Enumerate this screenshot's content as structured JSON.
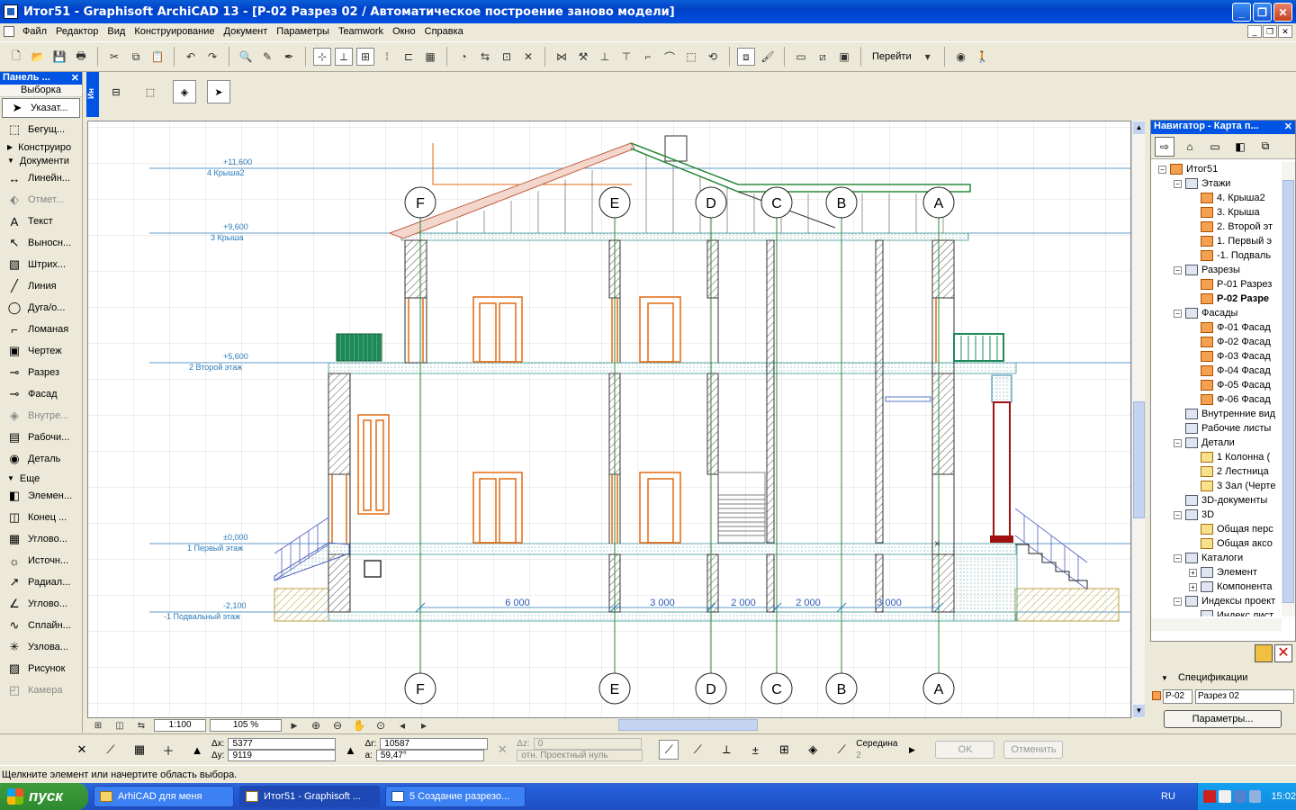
{
  "window": {
    "title": "Итог51 - Graphisoft ArchiCAD 13 - [Р-02 Разрез 02 / Автоматическое построение заново модели]"
  },
  "menu": [
    "Файл",
    "Редактор",
    "Вид",
    "Конструирование",
    "Документ",
    "Параметры",
    "Teamwork",
    "Окно",
    "Справка"
  ],
  "toolbar": {
    "goto_label": "Перейти"
  },
  "toolbox": {
    "title": "Панель ...",
    "selection_header": "Выборка",
    "select_tools": [
      {
        "label": "Указат...",
        "icon": "arrow-pointer-icon",
        "active": true
      },
      {
        "label": "Бегущ...",
        "icon": "marquee-icon"
      }
    ],
    "groups": [
      {
        "label": "Конструиро",
        "open": false
      },
      {
        "label": "Документи",
        "open": true
      }
    ],
    "doc_tools": [
      {
        "label": "Линейн...",
        "glyph": "↔",
        "name": "dimension-tool"
      },
      {
        "label": "Отмет...",
        "glyph": "⬖",
        "name": "level-dimension-tool",
        "dim": true
      },
      {
        "label": "Текст",
        "glyph": "A",
        "name": "text-tool"
      },
      {
        "label": "Выносн...",
        "glyph": "↖",
        "name": "label-tool"
      },
      {
        "label": "Штрих...",
        "glyph": "▧",
        "name": "fill-tool"
      },
      {
        "label": "Линия",
        "glyph": "╱",
        "name": "line-tool"
      },
      {
        "label": "Дуга/о...",
        "glyph": "◯",
        "name": "arc-tool"
      },
      {
        "label": "Ломаная",
        "glyph": "⌐",
        "name": "polyline-tool"
      },
      {
        "label": "Чертеж",
        "glyph": "▣",
        "name": "drawing-tool"
      },
      {
        "label": "Разрез",
        "glyph": "⊸",
        "name": "section-tool"
      },
      {
        "label": "Фасад",
        "glyph": "⊸",
        "name": "elevation-tool"
      },
      {
        "label": "Внутре...",
        "glyph": "◈",
        "name": "interior-elevation-tool",
        "dim": true
      },
      {
        "label": "Рабочи...",
        "glyph": "▤",
        "name": "worksheet-tool"
      },
      {
        "label": "Деталь",
        "glyph": "◉",
        "name": "detail-tool"
      }
    ],
    "more_header": "Еще",
    "more_tools": [
      {
        "label": "Элемен...",
        "glyph": "◧",
        "name": "object-tool"
      },
      {
        "label": "Конец ...",
        "glyph": "◫",
        "name": "wall-end-tool"
      },
      {
        "label": "Углово...",
        "glyph": "▦",
        "name": "corner-window-tool"
      },
      {
        "label": "Источн...",
        "glyph": "☼",
        "name": "lamp-tool"
      },
      {
        "label": "Радиал...",
        "glyph": "↗",
        "name": "radial-dimension-tool"
      },
      {
        "label": "Углово...",
        "glyph": "∠",
        "name": "angle-dimension-tool"
      },
      {
        "label": "Сплайн...",
        "glyph": "∿",
        "name": "spline-tool"
      },
      {
        "label": "Узлова...",
        "glyph": "✳",
        "name": "hotspot-tool"
      },
      {
        "label": "Рисунок",
        "glyph": "▨",
        "name": "figure-tool"
      },
      {
        "label": "Камера",
        "glyph": "◰",
        "name": "camera-tool",
        "dim": true
      }
    ]
  },
  "infobox": {
    "strip_label": "Ин"
  },
  "drawing": {
    "levels": [
      {
        "value": "+11,600",
        "name": "4 Крыша2"
      },
      {
        "value": "+9,600",
        "name": "3 Крыша"
      },
      {
        "value": "+5,600",
        "name": "2 Второй этаж"
      },
      {
        "value": "±0,000",
        "name": "1 Первый этаж"
      },
      {
        "value": "-2,100",
        "name": "-1 Подвальный этаж"
      }
    ],
    "axes": [
      "F",
      "E",
      "D",
      "C",
      "B",
      "A"
    ],
    "dimensions": [
      "6 000",
      "3 000",
      "2 000",
      "2 000",
      "3 000"
    ]
  },
  "canvasbar": {
    "scale": "1:100",
    "zoom": "105 %"
  },
  "navigator": {
    "title": "Навигатор - Карта п...",
    "tree": [
      {
        "label": "Итог51",
        "level": 0,
        "exp": "−",
        "icon": "house"
      },
      {
        "label": "Этажи",
        "level": 1,
        "exp": "−",
        "icon": "g"
      },
      {
        "label": "4. Крыша2",
        "level": 2,
        "icon": "s"
      },
      {
        "label": "3. Крыша",
        "level": 2,
        "icon": "s"
      },
      {
        "label": "2. Второй эт",
        "level": 2,
        "icon": "s"
      },
      {
        "label": "1. Первый э",
        "level": 2,
        "icon": "s"
      },
      {
        "label": "-1. Подваль",
        "level": 2,
        "icon": "s"
      },
      {
        "label": "Разрезы",
        "level": 1,
        "exp": "−",
        "icon": "g"
      },
      {
        "label": "Р-01 Разрез",
        "level": 2,
        "icon": "s"
      },
      {
        "label": "Р-02 Разре",
        "level": 2,
        "icon": "s",
        "bold": true
      },
      {
        "label": "Фасады",
        "level": 1,
        "exp": "−",
        "icon": "g"
      },
      {
        "label": "Ф-01 Фасад",
        "level": 2,
        "icon": "s"
      },
      {
        "label": "Ф-02 Фасад",
        "level": 2,
        "icon": "s"
      },
      {
        "label": "Ф-03 Фасад",
        "level": 2,
        "icon": "s"
      },
      {
        "label": "Ф-04 Фасад",
        "level": 2,
        "icon": "s"
      },
      {
        "label": "Ф-05 Фасад",
        "level": 2,
        "icon": "s"
      },
      {
        "label": "Ф-06 Фасад",
        "level": 2,
        "icon": "s"
      },
      {
        "label": "Внутренние вид",
        "level": 1,
        "icon": "g"
      },
      {
        "label": "Рабочие листы",
        "level": 1,
        "icon": "g"
      },
      {
        "label": "Детали",
        "level": 1,
        "exp": "−",
        "icon": "g"
      },
      {
        "label": "1 Колонна (",
        "level": 2,
        "icon": "f"
      },
      {
        "label": "2 Лестница",
        "level": 2,
        "icon": "f"
      },
      {
        "label": "3 Зал (Черте",
        "level": 2,
        "icon": "f"
      },
      {
        "label": "3D-документы",
        "level": 1,
        "icon": "g"
      },
      {
        "label": "3D",
        "level": 1,
        "exp": "−",
        "icon": "g"
      },
      {
        "label": "Общая перс",
        "level": 2,
        "icon": "f"
      },
      {
        "label": "Общая аксо",
        "level": 2,
        "icon": "f"
      },
      {
        "label": "Каталоги",
        "level": 1,
        "exp": "−",
        "icon": "g"
      },
      {
        "label": "Элемент",
        "level": 2,
        "exp": "+",
        "icon": "g"
      },
      {
        "label": "Компонента",
        "level": 2,
        "exp": "+",
        "icon": "g"
      },
      {
        "label": "Индексы проект",
        "level": 1,
        "exp": "−",
        "icon": "g"
      },
      {
        "label": "Индекс лист",
        "level": 2,
        "icon": "g"
      }
    ],
    "specs_label": "Спецификации",
    "spec_id": "Р-02",
    "spec_name": "Разрез 02",
    "params_button": "Параметры..."
  },
  "controlbar": {
    "dx_label": "Δx:",
    "dx": "5377",
    "dy_label": "Δy:",
    "dy": "9119",
    "dr_label": "Δr:",
    "dr": "10587",
    "da_label": "a:",
    "da": "59,47°",
    "dz_label": "Δz:",
    "dz": "0",
    "ref_label": "отн. Проектный нуль",
    "snap_label": "Середина",
    "snap_value": "2",
    "ok_label": "OK",
    "cancel_label": "Отменить"
  },
  "status": "Щелкните элемент или начертите область выбора.",
  "taskbar": {
    "start": "пуск",
    "tasks": [
      "ArhiCAD для меня",
      "Итог51 - Graphisoft ...",
      "5 Создание разрезо..."
    ],
    "lang": "RU",
    "clock": "15:02"
  }
}
